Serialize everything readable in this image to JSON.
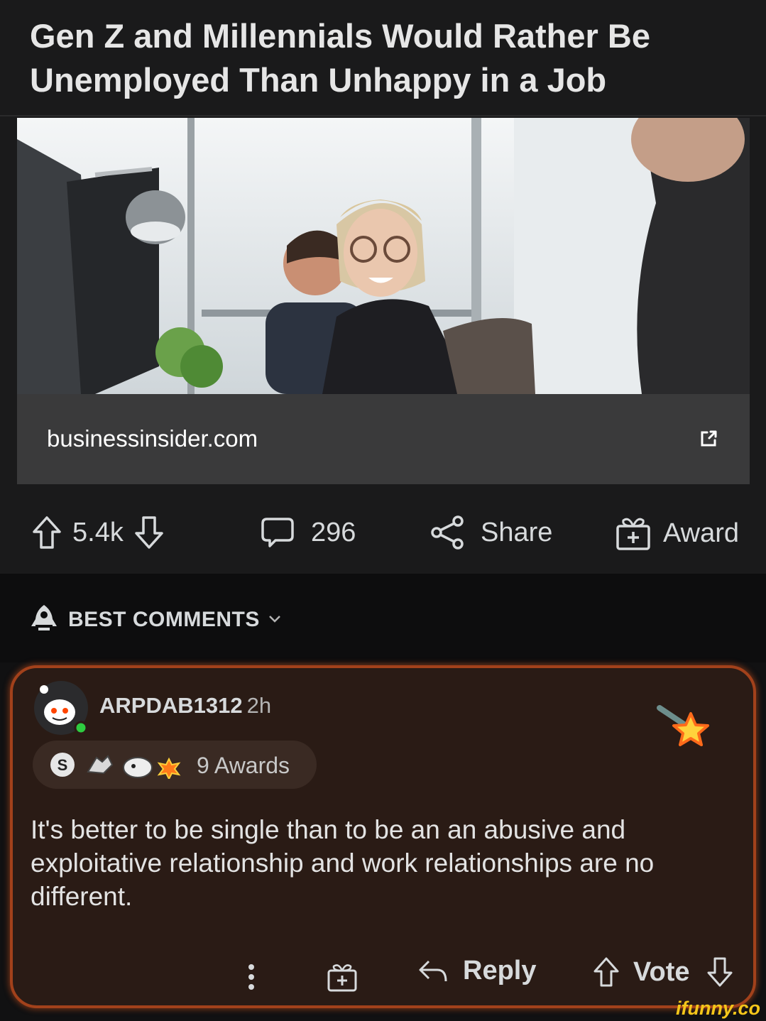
{
  "post": {
    "title": "Gen Z and Millennials Would Rather Be Unemployed Than Unhappy in a Job",
    "domain": "businessinsider.com"
  },
  "actions": {
    "upvotes": "5.4k",
    "comments": "296",
    "share_label": "Share",
    "award_label": "Award"
  },
  "sort": {
    "label": "BEST COMMENTS"
  },
  "comment": {
    "author": "ARPDAB1312",
    "time": "2h",
    "awards_label": "9 Awards",
    "body": "It's better to be single than to be an an abusive and exploitative relationship and work relationships are no different.",
    "reply_label": "Reply",
    "vote_label": "Vote"
  },
  "watermark": "ifunny.co",
  "icons": [
    "upvote-icon",
    "downvote-icon",
    "comment-icon",
    "share-icon",
    "gift-icon",
    "rocket-icon",
    "chevron-down-icon",
    "external-link-icon",
    "more-vertical-icon",
    "reply-icon"
  ],
  "colors": {
    "background": "#111112",
    "card": "#1a1a1b",
    "comment_card": "#2a1b15",
    "comment_border": "#a2411b",
    "online_dot": "#2ecc40",
    "watermark": "#f4c61a"
  }
}
